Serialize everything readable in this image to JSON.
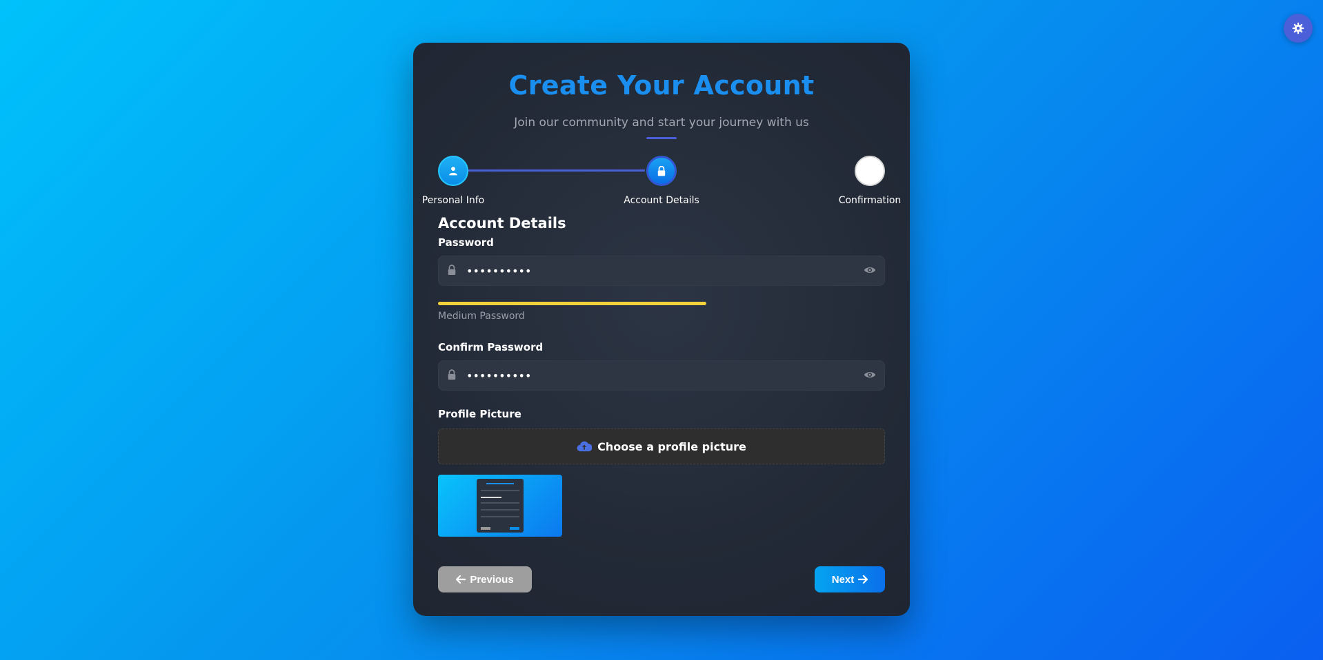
{
  "header": {
    "title": "Create Your Account",
    "subtitle": "Join our community and start your journey with us"
  },
  "stepper": {
    "steps": [
      {
        "label": "Personal Info",
        "state": "completed",
        "icon": "user-icon"
      },
      {
        "label": "Account Details",
        "state": "active",
        "icon": "lock-icon"
      },
      {
        "label": "Confirmation",
        "state": "pending",
        "icon": ""
      }
    ]
  },
  "form": {
    "section_title": "Account Details",
    "password": {
      "label": "Password",
      "value": "••••••••••",
      "strength_text": "Medium Password",
      "strength_fraction": 0.6,
      "strength_color": "#f2d13a"
    },
    "confirm_password": {
      "label": "Confirm Password",
      "value": "••••••••••"
    },
    "profile_picture": {
      "label": "Profile Picture",
      "upload_text": "Choose a profile picture"
    }
  },
  "buttons": {
    "previous": "Previous",
    "next": "Next"
  },
  "colors": {
    "accent": "#1a8ff0",
    "step_line": "#4a5fd8",
    "card_bg": "#232a37"
  },
  "theme_toggle": {
    "icon": "gear-icon"
  }
}
